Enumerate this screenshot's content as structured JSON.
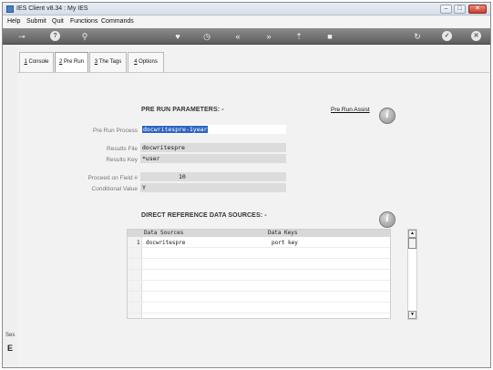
{
  "window": {
    "title": "IES Client v8.34 : My IES"
  },
  "window_buttons": {
    "minimize": "–",
    "maximize": "□",
    "close": "✕"
  },
  "menu": [
    "Help",
    "Submit",
    "Quit",
    "Functions",
    "Commands"
  ],
  "toolbar": [
    {
      "name": "key-icon",
      "glyph": "⊸"
    },
    {
      "name": "help-icon",
      "glyph": "?"
    },
    {
      "name": "search-icon",
      "glyph": "⚲"
    },
    {
      "name": "heart-icon",
      "glyph": "♥"
    },
    {
      "name": "clock-icon",
      "glyph": "◷"
    },
    {
      "name": "rewind-icon",
      "glyph": "«"
    },
    {
      "name": "forward-icon",
      "glyph": "»"
    },
    {
      "name": "upload-icon",
      "glyph": "⇡"
    },
    {
      "name": "stop-icon",
      "glyph": "■"
    },
    {
      "name": "refresh-icon",
      "glyph": "↻"
    },
    {
      "name": "ok-icon",
      "glyph": "✓"
    },
    {
      "name": "cancel-icon",
      "glyph": "✕"
    }
  ],
  "tabs": [
    {
      "num": "1",
      "label": " Console"
    },
    {
      "num": "2",
      "label": " Pre Run"
    },
    {
      "num": "3",
      "label": " The Tags"
    },
    {
      "num": "4",
      "label": " Options"
    }
  ],
  "prerun": {
    "title": "PRE RUN PARAMETERS: -",
    "assist_link": "Pre Run Assist",
    "info_glyph": "i",
    "labels": {
      "pre_run_process": "Pre Run Process",
      "results_file": "Results File",
      "results_key": "Results Key",
      "proceed_on_field": "Proceed on Field #",
      "conditional_value": "Conditional Value"
    },
    "values": {
      "pre_run_process": "docwritespre-1year",
      "results_file": "docwritespre",
      "results_key": "*user",
      "proceed_on_field": "10",
      "conditional_value": "Y"
    }
  },
  "sources": {
    "title": "DIRECT REFERENCE DATA SOURCES: -",
    "columns": [
      "Data Sources",
      "Data Keys"
    ],
    "rows": [
      {
        "num": "1",
        "source": "docwritespre",
        "key": "port key"
      }
    ],
    "scroll_up": "▲",
    "scroll_down": "▼"
  },
  "left_strip": {
    "text": "Ses",
    "glyph": "E"
  }
}
